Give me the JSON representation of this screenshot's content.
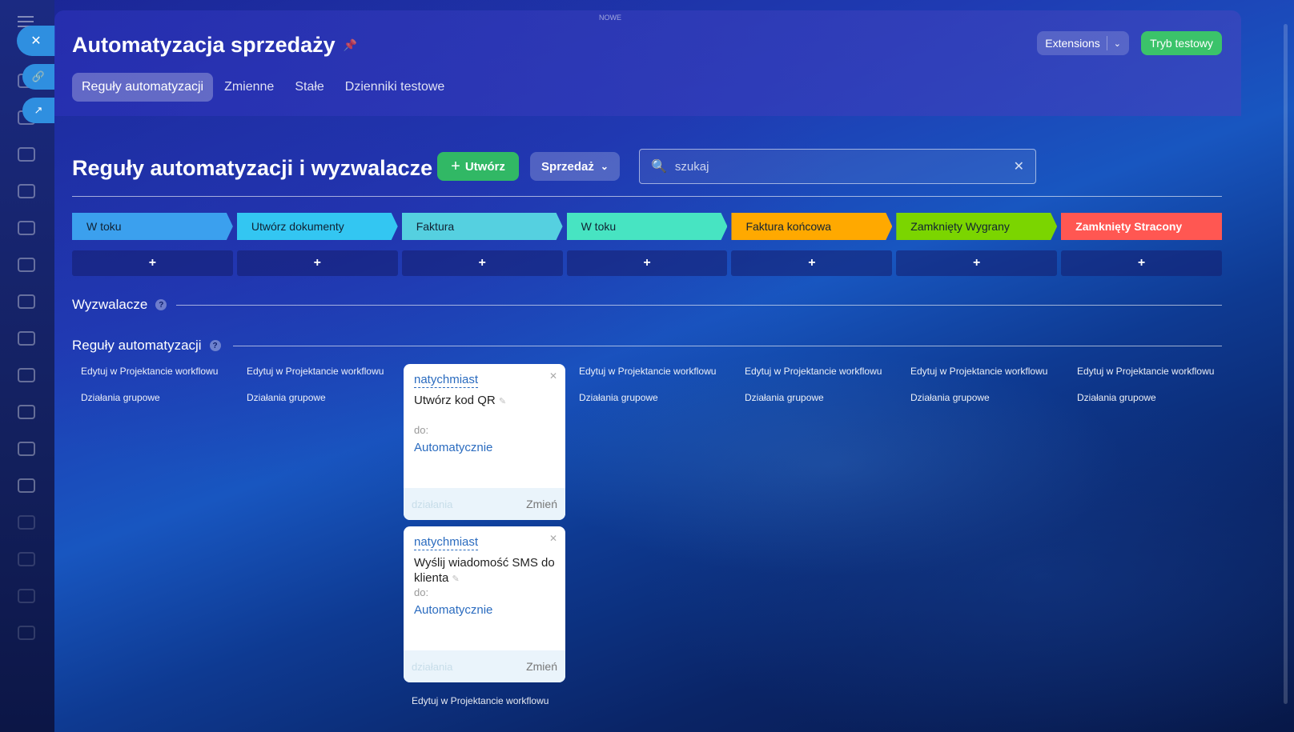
{
  "top_label": "NOWE",
  "header": {
    "title": "Automatyzacja sprzedaży",
    "extensions_label": "Extensions",
    "test_mode_label": "Tryb testowy"
  },
  "tabs": [
    {
      "label": "Reguły automatyzacji"
    },
    {
      "label": "Zmienne"
    },
    {
      "label": "Stałe"
    },
    {
      "label": "Dzienniki testowe"
    }
  ],
  "main": {
    "heading": "Reguły automatyzacji i wyzwalacze",
    "create_label": "Utwórz",
    "pipeline_label": "Sprzedaż",
    "search_placeholder": "szukaj"
  },
  "stages": [
    {
      "label": "W toku",
      "color": "#3ba0ee"
    },
    {
      "label": "Utwórz dokumenty",
      "color": "#33c6f2"
    },
    {
      "label": "Faktura",
      "color": "#55d0e0"
    },
    {
      "label": "W toku",
      "color": "#47e4c2"
    },
    {
      "label": "Faktura końcowa",
      "color": "#ffa900"
    },
    {
      "label": "Zamknięty Wygrany",
      "color": "#7bd500"
    },
    {
      "label": "Zamknięty Stracony",
      "color": "#ff5752"
    }
  ],
  "add_symbol": "+",
  "sections": {
    "triggers": "Wyzwalacze",
    "rules": "Reguły automatyzacji"
  },
  "column_links": {
    "edit": "Edytuj w Projektancie workflowu",
    "group": "Działania grupowe"
  },
  "cards": [
    {
      "when": "natychmiast",
      "name": "Utwórz kod QR",
      "to_label": "do:",
      "to_value": "Automatycznie",
      "footer_left": "działania",
      "footer_right": "Zmień"
    },
    {
      "when": "natychmiast",
      "name": "Wyślij wiadomość SMS do klienta",
      "to_label": "do:",
      "to_value": "Automatycznie",
      "footer_left": "działania",
      "footer_right": "Zmień"
    }
  ]
}
